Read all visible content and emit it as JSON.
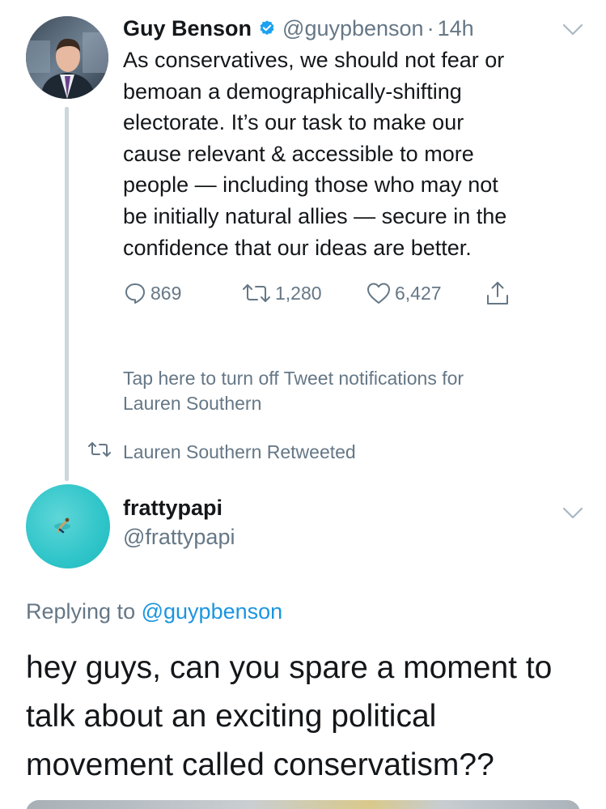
{
  "tweet": {
    "author_name": "Guy Benson",
    "author_handle": "@guypbenson",
    "separator": "·",
    "time": "14h",
    "verified": true,
    "body_lines": [
      "As conservatives, we should not fear or",
      "bemoan a demographically-shifting",
      "electorate. It’s our task to make our",
      "cause relevant & accessible to more",
      "people — including those who may not",
      "be initially natural allies — secure in the",
      "confidence that our ideas are better."
    ],
    "actions": {
      "replies": "869",
      "retweets": "1,280",
      "likes": "6,427"
    }
  },
  "notification_prompt": {
    "lines": [
      "Tap here to turn off Tweet notifications for",
      "Lauren Southern"
    ]
  },
  "retweet_context": {
    "label": "Lauren Southern Retweeted"
  },
  "reply": {
    "author_name": "frattypapi",
    "author_handle": "@frattypapi",
    "replying_prefix": "Replying to",
    "replying_to": "@guypbenson",
    "body_lines": [
      "hey guys, can you spare a moment to",
      "talk about an exciting political",
      "movement called conservatism??"
    ]
  },
  "colors": {
    "text_primary": "#14171a",
    "text_secondary": "#657786",
    "link": "#1b95e0",
    "verified": "#1da1f2",
    "thread_line": "#ccd6dd"
  },
  "icons": {
    "reply": "speech-bubble-icon",
    "retweet": "retweet-arrows-icon",
    "like": "heart-icon",
    "share": "share-upload-icon",
    "verified": "verified-badge-icon",
    "menu": "chevron-down-icon"
  }
}
